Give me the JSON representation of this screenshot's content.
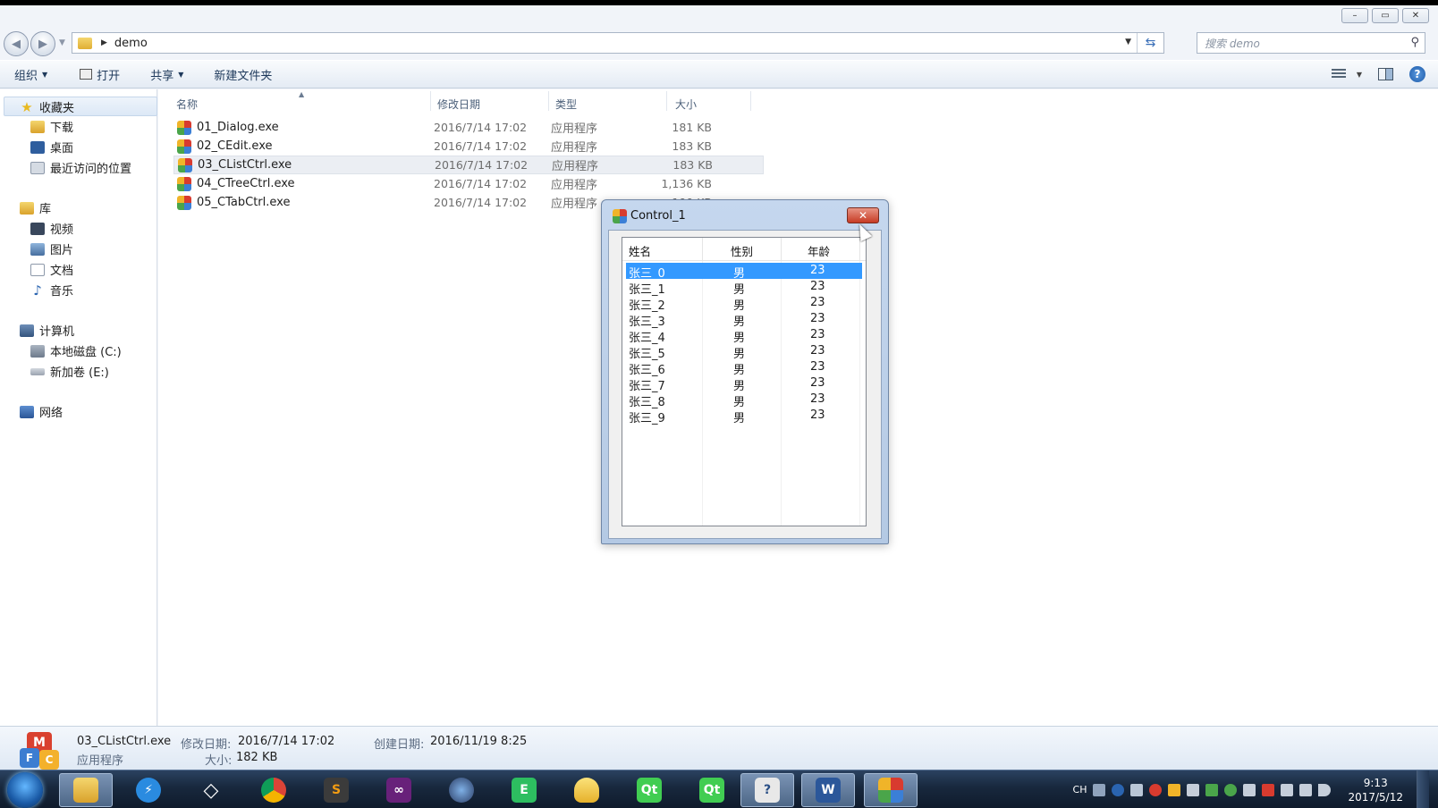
{
  "window": {
    "controls": [
      "–",
      "▭",
      "✕"
    ]
  },
  "address": {
    "folder": "demo",
    "search_placeholder": "搜索 demo"
  },
  "toolbar": {
    "organize": "组织",
    "open": "打开",
    "share": "共享",
    "new_folder": "新建文件夹"
  },
  "nav": {
    "favorites": "收藏夹",
    "downloads": "下载",
    "desktop": "桌面",
    "recent": "最近访问的位置",
    "libraries": "库",
    "videos": "视频",
    "pictures": "图片",
    "documents": "文档",
    "music": "音乐",
    "computer": "计算机",
    "drive_c": "本地磁盘 (C:)",
    "drive_e": "新加卷 (E:)",
    "network": "网络"
  },
  "columns": {
    "name": "名称",
    "modified": "修改日期",
    "type": "类型",
    "size": "大小"
  },
  "files": [
    {
      "name": "01_Dialog.exe",
      "date": "2016/7/14 17:02",
      "type": "应用程序",
      "size": "181 KB"
    },
    {
      "name": "02_CEdit.exe",
      "date": "2016/7/14 17:02",
      "type": "应用程序",
      "size": "183 KB"
    },
    {
      "name": "03_CListCtrl.exe",
      "date": "2016/7/14 17:02",
      "type": "应用程序",
      "size": "183 KB",
      "selected": true
    },
    {
      "name": "04_CTreeCtrl.exe",
      "date": "2016/7/14 17:02",
      "type": "应用程序",
      "size": "1,136 KB"
    },
    {
      "name": "05_CTabCtrl.exe",
      "date": "2016/7/14 17:02",
      "type": "应用程序",
      "size": "190 KB"
    }
  ],
  "details": {
    "filename": "03_CListCtrl.exe",
    "modified_label": "修改日期:",
    "modified_value": "2016/7/14 17:02",
    "created_label": "创建日期:",
    "created_value": "2016/11/19 8:25",
    "type": "应用程序",
    "size_label": "大小:",
    "size_value": "182 KB"
  },
  "dialog": {
    "title": "Control_1",
    "close": "✕",
    "headers": [
      "姓名",
      "性别",
      "年龄"
    ],
    "rows": [
      [
        "张三_0",
        "男",
        "23"
      ],
      [
        "张三_1",
        "男",
        "23"
      ],
      [
        "张三_2",
        "男",
        "23"
      ],
      [
        "张三_3",
        "男",
        "23"
      ],
      [
        "张三_4",
        "男",
        "23"
      ],
      [
        "张三_5",
        "男",
        "23"
      ],
      [
        "张三_6",
        "男",
        "23"
      ],
      [
        "张三_7",
        "男",
        "23"
      ],
      [
        "张三_8",
        "男",
        "23"
      ],
      [
        "张三_9",
        "男",
        "23"
      ]
    ]
  },
  "taskbar": {
    "apps": [
      "explorer",
      "thunder",
      "unity",
      "chrome",
      "sublime",
      "visual-studio",
      "eclipse",
      "evernote",
      "folder",
      "qt-creator",
      "qt-designer",
      "help",
      "word",
      "mfc-app"
    ],
    "lang": "CH",
    "time": "9:13",
    "date": "2017/5/12"
  }
}
